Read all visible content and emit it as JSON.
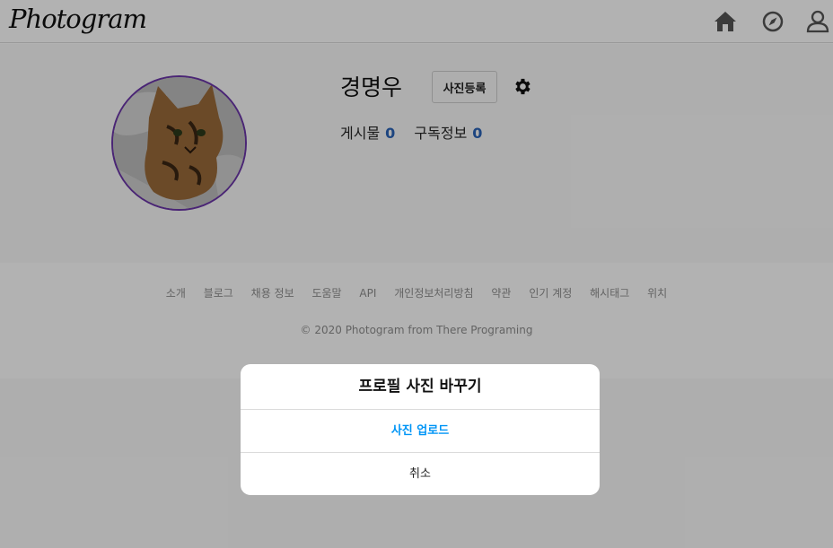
{
  "header": {
    "logo_text": "Photogram",
    "icons": [
      "home-icon",
      "compass-icon",
      "user-icon"
    ]
  },
  "profile": {
    "username": "경명우",
    "upload_button_label": "사진등록",
    "stats": [
      {
        "label": "게시물",
        "value": "0"
      },
      {
        "label": "구독정보",
        "value": "0"
      }
    ]
  },
  "footer": {
    "links": [
      "소개",
      "블로그",
      "채용 정보",
      "도움말",
      "API",
      "개인정보처리방침",
      "약관",
      "인기 계정",
      "해시태그",
      "위치"
    ],
    "copyright": "© 2020 Photogram from There Programing"
  },
  "modal": {
    "title": "프로필 사진 바꾸기",
    "upload_label": "사진 업로드",
    "cancel_label": "취소"
  },
  "colors": {
    "accent": "#0095f6",
    "avatar_ring": "#6b35a8",
    "stat_number": "#2a64b8"
  }
}
